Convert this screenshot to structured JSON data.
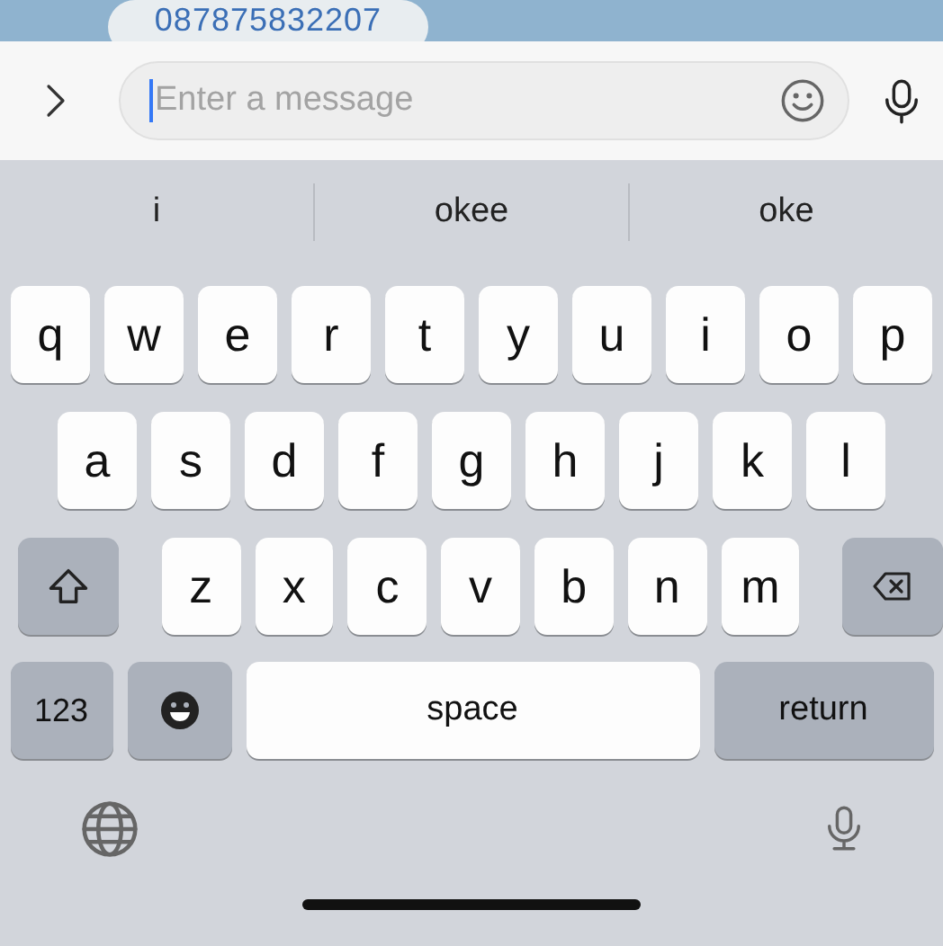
{
  "chat": {
    "bubble_text": "087875832207"
  },
  "composer": {
    "placeholder": "Enter a message"
  },
  "suggestions": [
    {
      "text": "i"
    },
    {
      "text": "okee"
    },
    {
      "text": "oke"
    }
  ],
  "keyboard": {
    "rows": [
      {
        "keys": [
          {
            "kind": "letter",
            "label": "q"
          },
          {
            "kind": "letter",
            "label": "w"
          },
          {
            "kind": "letter",
            "label": "e"
          },
          {
            "kind": "letter",
            "label": "r"
          },
          {
            "kind": "letter",
            "label": "t"
          },
          {
            "kind": "letter",
            "label": "y"
          },
          {
            "kind": "letter",
            "label": "u"
          },
          {
            "kind": "letter",
            "label": "i"
          },
          {
            "kind": "letter",
            "label": "o"
          },
          {
            "kind": "letter",
            "label": "p"
          }
        ]
      },
      {
        "keys": [
          {
            "kind": "letter",
            "label": "a"
          },
          {
            "kind": "letter",
            "label": "s"
          },
          {
            "kind": "letter",
            "label": "d"
          },
          {
            "kind": "letter",
            "label": "f"
          },
          {
            "kind": "letter",
            "label": "g"
          },
          {
            "kind": "letter",
            "label": "h"
          },
          {
            "kind": "letter",
            "label": "j"
          },
          {
            "kind": "letter",
            "label": "k"
          },
          {
            "kind": "letter",
            "label": "l"
          }
        ]
      },
      {
        "keys": [
          {
            "kind": "shift"
          },
          {
            "kind": "letter",
            "label": "z"
          },
          {
            "kind": "letter",
            "label": "x"
          },
          {
            "kind": "letter",
            "label": "c"
          },
          {
            "kind": "letter",
            "label": "v"
          },
          {
            "kind": "letter",
            "label": "b"
          },
          {
            "kind": "letter",
            "label": "n"
          },
          {
            "kind": "letter",
            "label": "m"
          },
          {
            "kind": "backspace"
          }
        ]
      },
      {
        "keys": [
          {
            "kind": "numbers",
            "label": "123"
          },
          {
            "kind": "emoji"
          },
          {
            "kind": "space",
            "label": "space"
          },
          {
            "kind": "return",
            "label": "return"
          }
        ]
      }
    ]
  }
}
